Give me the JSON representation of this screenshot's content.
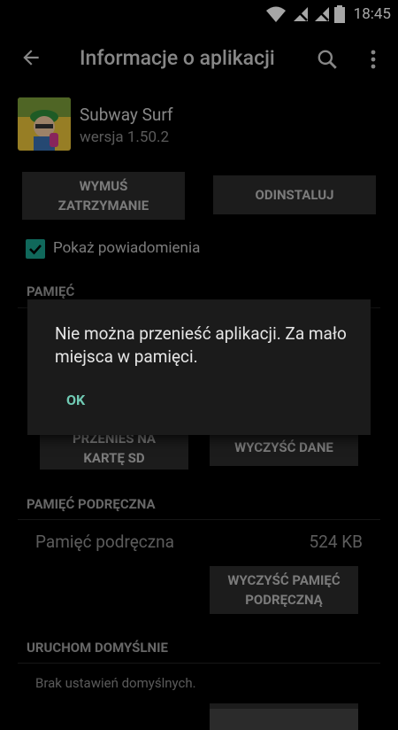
{
  "status_bar": {
    "time": "18:45"
  },
  "toolbar": {
    "title": "Informacje o aplikacji"
  },
  "app": {
    "name": "Subway Surf",
    "version": "wersja 1.50.2"
  },
  "actions": {
    "force_stop_line1": "WYMUŚ",
    "force_stop_line2": "ZATRZYMANIE",
    "uninstall": "ODINSTALUJ"
  },
  "notifications": {
    "label": "Pokaż powiadomienia",
    "checked": true
  },
  "storage": {
    "header": "PAMIĘĆ",
    "move_line1": "PRZENIEŚ NA",
    "move_line2": "KARTĘ SD",
    "clear_data": "WYCZYŚĆ DANE"
  },
  "cache": {
    "header": "PAMIĘĆ PODRĘCZNA",
    "label": "Pamięć podręczna",
    "value": "524 KB",
    "clear_line1": "WYCZYŚĆ PAMIĘĆ",
    "clear_line2": "PODRĘCZNĄ"
  },
  "defaults": {
    "header": "URUCHOM DOMYŚLNIE",
    "text": "Brak ustawień domyślnych."
  },
  "dialog": {
    "message": "Nie można przenieść aplikacji. Za mało miejsca w pamięci.",
    "ok": "OK"
  },
  "colors": {
    "accent": "#1aa08c",
    "dialog_button": "#70c9b3",
    "background": "#000000"
  }
}
